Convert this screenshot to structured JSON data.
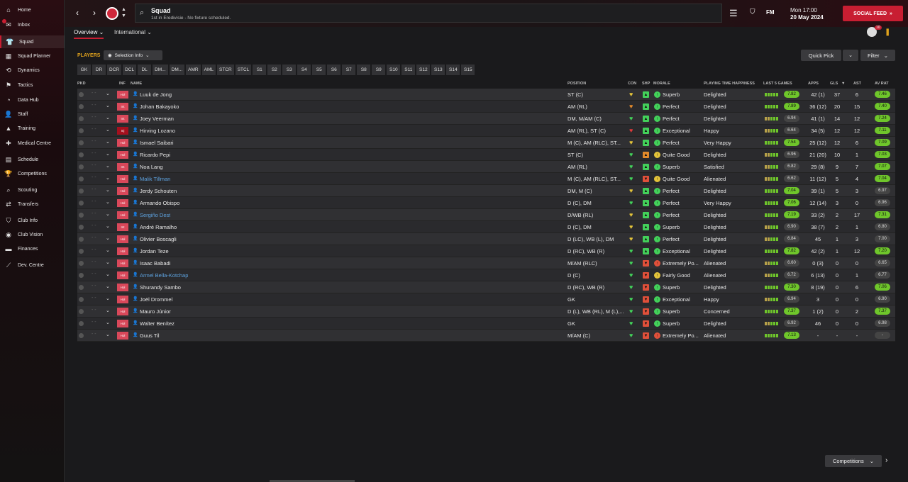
{
  "sidebar": {
    "items": [
      {
        "label": "Home",
        "icon": "home-icon",
        "glyph": "⌂"
      },
      {
        "label": "Inbox",
        "icon": "inbox-icon",
        "glyph": "✉"
      },
      {
        "label": "Squad",
        "icon": "shirt-icon",
        "glyph": "👕"
      },
      {
        "label": "Squad Planner",
        "icon": "planner-icon",
        "glyph": "▦"
      },
      {
        "label": "Dynamics",
        "icon": "dynamics-icon",
        "glyph": "⟲"
      },
      {
        "label": "Tactics",
        "icon": "tactics-icon",
        "glyph": "⚑"
      },
      {
        "label": "Data Hub",
        "icon": "data-hub-icon",
        "glyph": "◔"
      },
      {
        "label": "Staff",
        "icon": "staff-icon",
        "glyph": "👤"
      },
      {
        "label": "Training",
        "icon": "training-icon",
        "glyph": "▲"
      },
      {
        "label": "Medical Centre",
        "icon": "medical-icon",
        "glyph": "✚"
      },
      {
        "label": "Schedule",
        "icon": "schedule-icon",
        "glyph": "▤"
      },
      {
        "label": "Competitions",
        "icon": "trophy-icon",
        "glyph": "🏆"
      },
      {
        "label": "Scouting",
        "icon": "scouting-icon",
        "glyph": "⌕"
      },
      {
        "label": "Transfers",
        "icon": "transfers-icon",
        "glyph": "⇄"
      },
      {
        "label": "Club Info",
        "icon": "shield-icon",
        "glyph": "⛉"
      },
      {
        "label": "Club Vision",
        "icon": "vision-icon",
        "glyph": "◉"
      },
      {
        "label": "Finances",
        "icon": "finances-icon",
        "glyph": "▬"
      },
      {
        "label": "Dev. Centre",
        "icon": "dev-centre-icon",
        "glyph": "⟋"
      }
    ],
    "active": "Squad"
  },
  "header": {
    "title": "Squad",
    "subtitle": "1st in Eredivisie - No fixture scheduled.",
    "date_line1": "Mon 17:00",
    "date_line2": "20 May 2024",
    "fm_logo": "FM",
    "social_feed": "SOCIAL FEED",
    "notification_count": "10"
  },
  "subnav": {
    "tabs": [
      "Overview",
      "International"
    ]
  },
  "toolbar": {
    "players_label": "PLAYERS",
    "selection_info": "Selection Info",
    "quick_pick": "Quick Pick",
    "filter": "Filter"
  },
  "position_filters": [
    "GK",
    "DR",
    "DCR",
    "DCL",
    "DL",
    "DM...",
    "DM...",
    "AMR",
    "AML",
    "STCR",
    "STCL",
    "S1",
    "S2",
    "S3",
    "S4",
    "S5",
    "S6",
    "S7",
    "S8",
    "S9",
    "S10",
    "S11",
    "S12",
    "S13",
    "S14",
    "S15"
  ],
  "table": {
    "columns": {
      "pkd": "PKD",
      "inf": "INF",
      "name": "NAME",
      "position": "POSITION",
      "con": "CON",
      "shp": "SHP",
      "morale": "MORALE",
      "pth": "PLAYING TIME HAPPINESS",
      "form": "LAST 5 GAMES",
      "apps": "APPS",
      "gls": "GLS",
      "ast": "AST",
      "avrat": "AV RAT"
    },
    "rows": [
      {
        "inf": "Hol",
        "name": "Luuk de Jong",
        "position": "ST (C)",
        "con": "yellow",
        "shp": "green",
        "morale": "Superb",
        "pth": "Delighted",
        "form": "7.82",
        "apps": "42 (1)",
        "gls": "37",
        "ast": "6",
        "avrat": "7.46",
        "rating_color": "#6fc62b",
        "avrat_color": "#6fc62b"
      },
      {
        "inf": "Int",
        "name": "Johan Bakayoko",
        "position": "AM (RL)",
        "con": "orange",
        "shp": "green",
        "morale": "Perfect",
        "pth": "Delighted",
        "form": "7.89",
        "apps": "36 (12)",
        "gls": "20",
        "ast": "15",
        "avrat": "7.40",
        "rating_color": "#6fc62b",
        "avrat_color": "#6fc62b"
      },
      {
        "inf": "Int",
        "name": "Joey Veerman",
        "position": "DM, M/AM (C)",
        "con": "green",
        "shp": "green",
        "morale": "Perfect",
        "pth": "Delighted",
        "form": "6.94",
        "apps": "41 (1)",
        "gls": "14",
        "ast": "12",
        "avrat": "7.24",
        "rating_color": "#444",
        "avrat_color": "#6fc62b"
      },
      {
        "inf": "Inj",
        "name": "Hirving Lozano",
        "position": "AM (RL), ST (C)",
        "con": "red",
        "shp": "green",
        "morale": "Exceptional",
        "pth": "Happy",
        "form": "6.64",
        "apps": "34 (5)",
        "gls": "12",
        "ast": "12",
        "avrat": "7.11",
        "rating_color": "#444",
        "avrat_color": "#6fc62b"
      },
      {
        "inf": "Hol",
        "name": "Ismael Saibari",
        "position": "M (C), AM (RLC), ST...",
        "con": "yellow",
        "shp": "green",
        "morale": "Perfect",
        "pth": "Very Happy",
        "form": "7.54",
        "apps": "25 (12)",
        "gls": "12",
        "ast": "6",
        "avrat": "7.09",
        "rating_color": "#6fc62b",
        "avrat_color": "#6fc62b"
      },
      {
        "inf": "Hol",
        "name": "Ricardo Pepi",
        "position": "ST (C)",
        "con": "green",
        "shp": "orange",
        "morale": "Quite Good",
        "pth": "Delighted",
        "form": "6.96",
        "apps": "21 (20)",
        "gls": "10",
        "ast": "1",
        "avrat": "7.03",
        "rating_color": "#444",
        "avrat_color": "#6fc62b"
      },
      {
        "inf": "Int",
        "name": "Noa Lang",
        "position": "AM (RL)",
        "con": "green",
        "shp": "green",
        "morale": "Superb",
        "pth": "Satisfied",
        "form": "6.82",
        "apps": "29 (8)",
        "gls": "9",
        "ast": "7",
        "avrat": "7.07",
        "rating_color": "#444",
        "avrat_color": "#6fc62b"
      },
      {
        "inf": "Hol",
        "name": "Malik Tillman",
        "position": "M (C), AM (RLC), ST...",
        "con": "green",
        "shp": "red",
        "morale": "Quite Good",
        "pth": "Alienated",
        "form": "6.62",
        "apps": "11 (12)",
        "gls": "5",
        "ast": "4",
        "avrat": "7.04",
        "rating_color": "#444",
        "avrat_color": "#6fc62b",
        "loan": true
      },
      {
        "inf": "Hol",
        "name": "Jerdy Schouten",
        "position": "DM, M (C)",
        "con": "yellow",
        "shp": "green",
        "morale": "Perfect",
        "pth": "Delighted",
        "form": "7.04",
        "apps": "39 (1)",
        "gls": "5",
        "ast": "3",
        "avrat": "6.97",
        "rating_color": "#6fc62b",
        "avrat_color": "#444"
      },
      {
        "inf": "Hol",
        "name": "Armando Obispo",
        "position": "D (C), DM",
        "con": "green",
        "shp": "green",
        "morale": "Perfect",
        "pth": "Very Happy",
        "form": "7.06",
        "apps": "12 (14)",
        "gls": "3",
        "ast": "0",
        "avrat": "6.96",
        "rating_color": "#6fc62b",
        "avrat_color": "#444"
      },
      {
        "inf": "Hol",
        "name": "Sergiño Dest",
        "position": "D/WB (RL)",
        "con": "yellow",
        "shp": "green",
        "morale": "Perfect",
        "pth": "Delighted",
        "form": "7.19",
        "apps": "33 (2)",
        "gls": "2",
        "ast": "17",
        "avrat": "7.31",
        "rating_color": "#6fc62b",
        "avrat_color": "#6fc62b",
        "loan": true
      },
      {
        "inf": "Int",
        "name": "André Ramalho",
        "position": "D (C), DM",
        "con": "yellow",
        "shp": "green",
        "morale": "Superb",
        "pth": "Delighted",
        "form": "6.90",
        "apps": "38 (7)",
        "gls": "2",
        "ast": "1",
        "avrat": "6.80",
        "rating_color": "#444",
        "avrat_color": "#444"
      },
      {
        "inf": "Hol",
        "name": "Olivier Boscagli",
        "position": "D (LC), WB (L), DM",
        "con": "yellow",
        "shp": "green",
        "morale": "Perfect",
        "pth": "Delighted",
        "form": "6.84",
        "apps": "45",
        "gls": "1",
        "ast": "3",
        "avrat": "7.00",
        "rating_color": "#444",
        "avrat_color": "#444"
      },
      {
        "inf": "Hol",
        "name": "Jordan Teze",
        "position": "D (RC), WB (R)",
        "con": "green",
        "shp": "green",
        "morale": "Exceptional",
        "pth": "Delighted",
        "form": "7.82",
        "apps": "42 (2)",
        "gls": "1",
        "ast": "12",
        "avrat": "7.20",
        "rating_color": "#6fc62b",
        "avrat_color": "#6fc62b"
      },
      {
        "inf": "Hol",
        "name": "Isaac Babadi",
        "position": "M/AM (RLC)",
        "con": "green",
        "shp": "red",
        "morale": "Extremely Po...",
        "pth": "Alienated",
        "form": "6.60",
        "apps": "0 (3)",
        "gls": "0",
        "ast": "0",
        "avrat": "6.65",
        "rating_color": "#444",
        "avrat_color": "#444"
      },
      {
        "inf": "Hol",
        "name": "Armel Bella-Kotchap",
        "position": "D (C)",
        "con": "green",
        "shp": "red",
        "morale": "Fairly Good",
        "pth": "Alienated",
        "form": "6.72",
        "apps": "6 (13)",
        "gls": "0",
        "ast": "1",
        "avrat": "6.77",
        "rating_color": "#444",
        "avrat_color": "#444",
        "loan": true
      },
      {
        "inf": "Hol",
        "name": "Shurandy Sambo",
        "position": "D (RC), WB (R)",
        "con": "green",
        "shp": "red",
        "morale": "Superb",
        "pth": "Delighted",
        "form": "7.30",
        "apps": "8 (19)",
        "gls": "0",
        "ast": "6",
        "avrat": "7.06",
        "rating_color": "#6fc62b",
        "avrat_color": "#6fc62b"
      },
      {
        "inf": "Hol",
        "name": "Joël Drommel",
        "position": "GK",
        "con": "green",
        "shp": "red",
        "morale": "Exceptional",
        "pth": "Happy",
        "form": "6.94",
        "apps": "3",
        "gls": "0",
        "ast": "0",
        "avrat": "6.90",
        "rating_color": "#444",
        "avrat_color": "#444"
      },
      {
        "inf": "Hol",
        "name": "Mauro Júnior",
        "position": "D (L), WB (RL), M (L),...",
        "con": "green",
        "shp": "red",
        "morale": "Superb",
        "pth": "Concerned",
        "form": "7.37",
        "apps": "1 (2)",
        "gls": "0",
        "ast": "2",
        "avrat": "7.37",
        "rating_color": "#6fc62b",
        "avrat_color": "#6fc62b"
      },
      {
        "inf": "Hol",
        "name": "Walter Benítez",
        "position": "GK",
        "con": "green",
        "shp": "red",
        "morale": "Superb",
        "pth": "Delighted",
        "form": "6.92",
        "apps": "46",
        "gls": "0",
        "ast": "0",
        "avrat": "6.98",
        "rating_color": "#444",
        "avrat_color": "#444"
      },
      {
        "inf": "Hol",
        "name": "Guus Til",
        "position": "M/AM (C)",
        "con": "green",
        "shp": "red",
        "morale": "Extremely Po...",
        "pth": "Alienated",
        "form": "7.13",
        "apps": "-",
        "gls": "-",
        "ast": "-",
        "avrat": "-",
        "rating_color": "#6fc62b",
        "avrat_color": "#444"
      }
    ]
  },
  "footer": {
    "competitions": "Competitions"
  },
  "colors": {
    "accent": "#c81e32",
    "gold": "#e0a21c",
    "good": "#6fc62b"
  }
}
